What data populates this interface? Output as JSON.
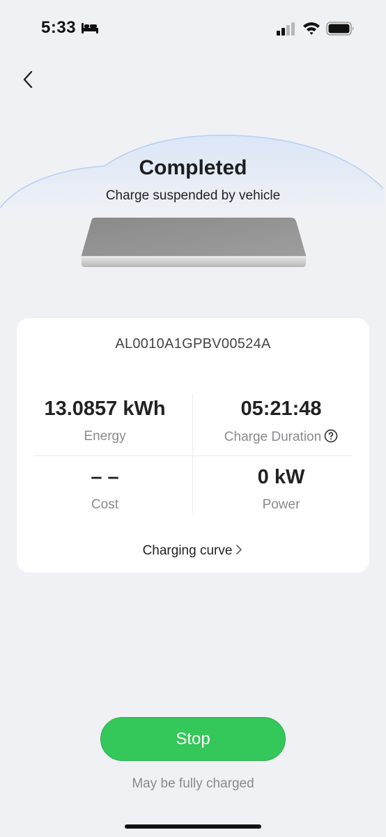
{
  "status_bar": {
    "time": "5:33",
    "icons": [
      "bed-icon",
      "signal-icon",
      "wifi-icon",
      "battery-icon"
    ]
  },
  "nav": {
    "back_icon": "chevron-left-icon"
  },
  "hero": {
    "title": "Completed",
    "subtitle": "Charge suspended by vehicle"
  },
  "card": {
    "charger_id": "AL0010A1GPBV00524A",
    "stats": {
      "energy": {
        "value": "13.0857 kWh",
        "label": "Energy"
      },
      "duration": {
        "value": "05:21:48",
        "label": "Charge Duration"
      },
      "cost": {
        "value": "– –",
        "label": "Cost"
      },
      "power": {
        "value": "0 kW",
        "label": "Power"
      }
    },
    "charging_curve_label": "Charging curve"
  },
  "actions": {
    "stop_label": "Stop",
    "hint": "May be fully charged"
  },
  "colors": {
    "background": "#f0f1f5",
    "accent_green": "#34c759",
    "card": "#ffffff",
    "muted_text": "#8a8a8e"
  }
}
